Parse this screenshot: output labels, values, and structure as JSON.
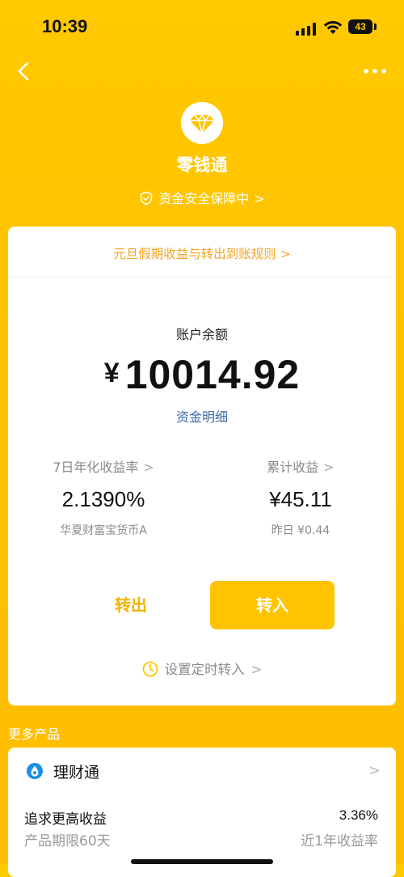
{
  "status_bar": {
    "time": "10:39",
    "battery": "43"
  },
  "header": {
    "title": "零钱通",
    "safety_text": "资金安全保障中",
    "chevron": ">"
  },
  "account": {
    "notice": "元旦假期收益与转出到账规则 >",
    "balance_label": "账户余额",
    "currency": "¥",
    "balance": "10014.92",
    "detail_link": "资金明细"
  },
  "stats": {
    "yield_label": "7日年化收益率",
    "yield_value": "2.1390%",
    "fund_name": "华夏财富宝货币A",
    "earnings_label": "累计收益",
    "earnings_value": "¥45.11",
    "yesterday": "昨日 ¥0.44",
    "chevron": ">"
  },
  "actions": {
    "transfer_out": "转出",
    "transfer_in": "转入",
    "schedule": "设置定时转入",
    "chevron": ">"
  },
  "more": {
    "title": "更多产品",
    "product": {
      "name": "理财通",
      "chevron": ">",
      "description": "追求更高收益",
      "rate": "3.36%",
      "term": "产品期限60天",
      "rate_label": "近1年收益率"
    }
  },
  "colors": {
    "accent": "#ffc300",
    "link": "#3e6aa6",
    "notice": "#f2a422"
  },
  "icons": [
    "back-arrow-icon",
    "more-dots-icon",
    "diamond-icon",
    "shield-icon",
    "clock-icon",
    "licaitong-icon"
  ]
}
